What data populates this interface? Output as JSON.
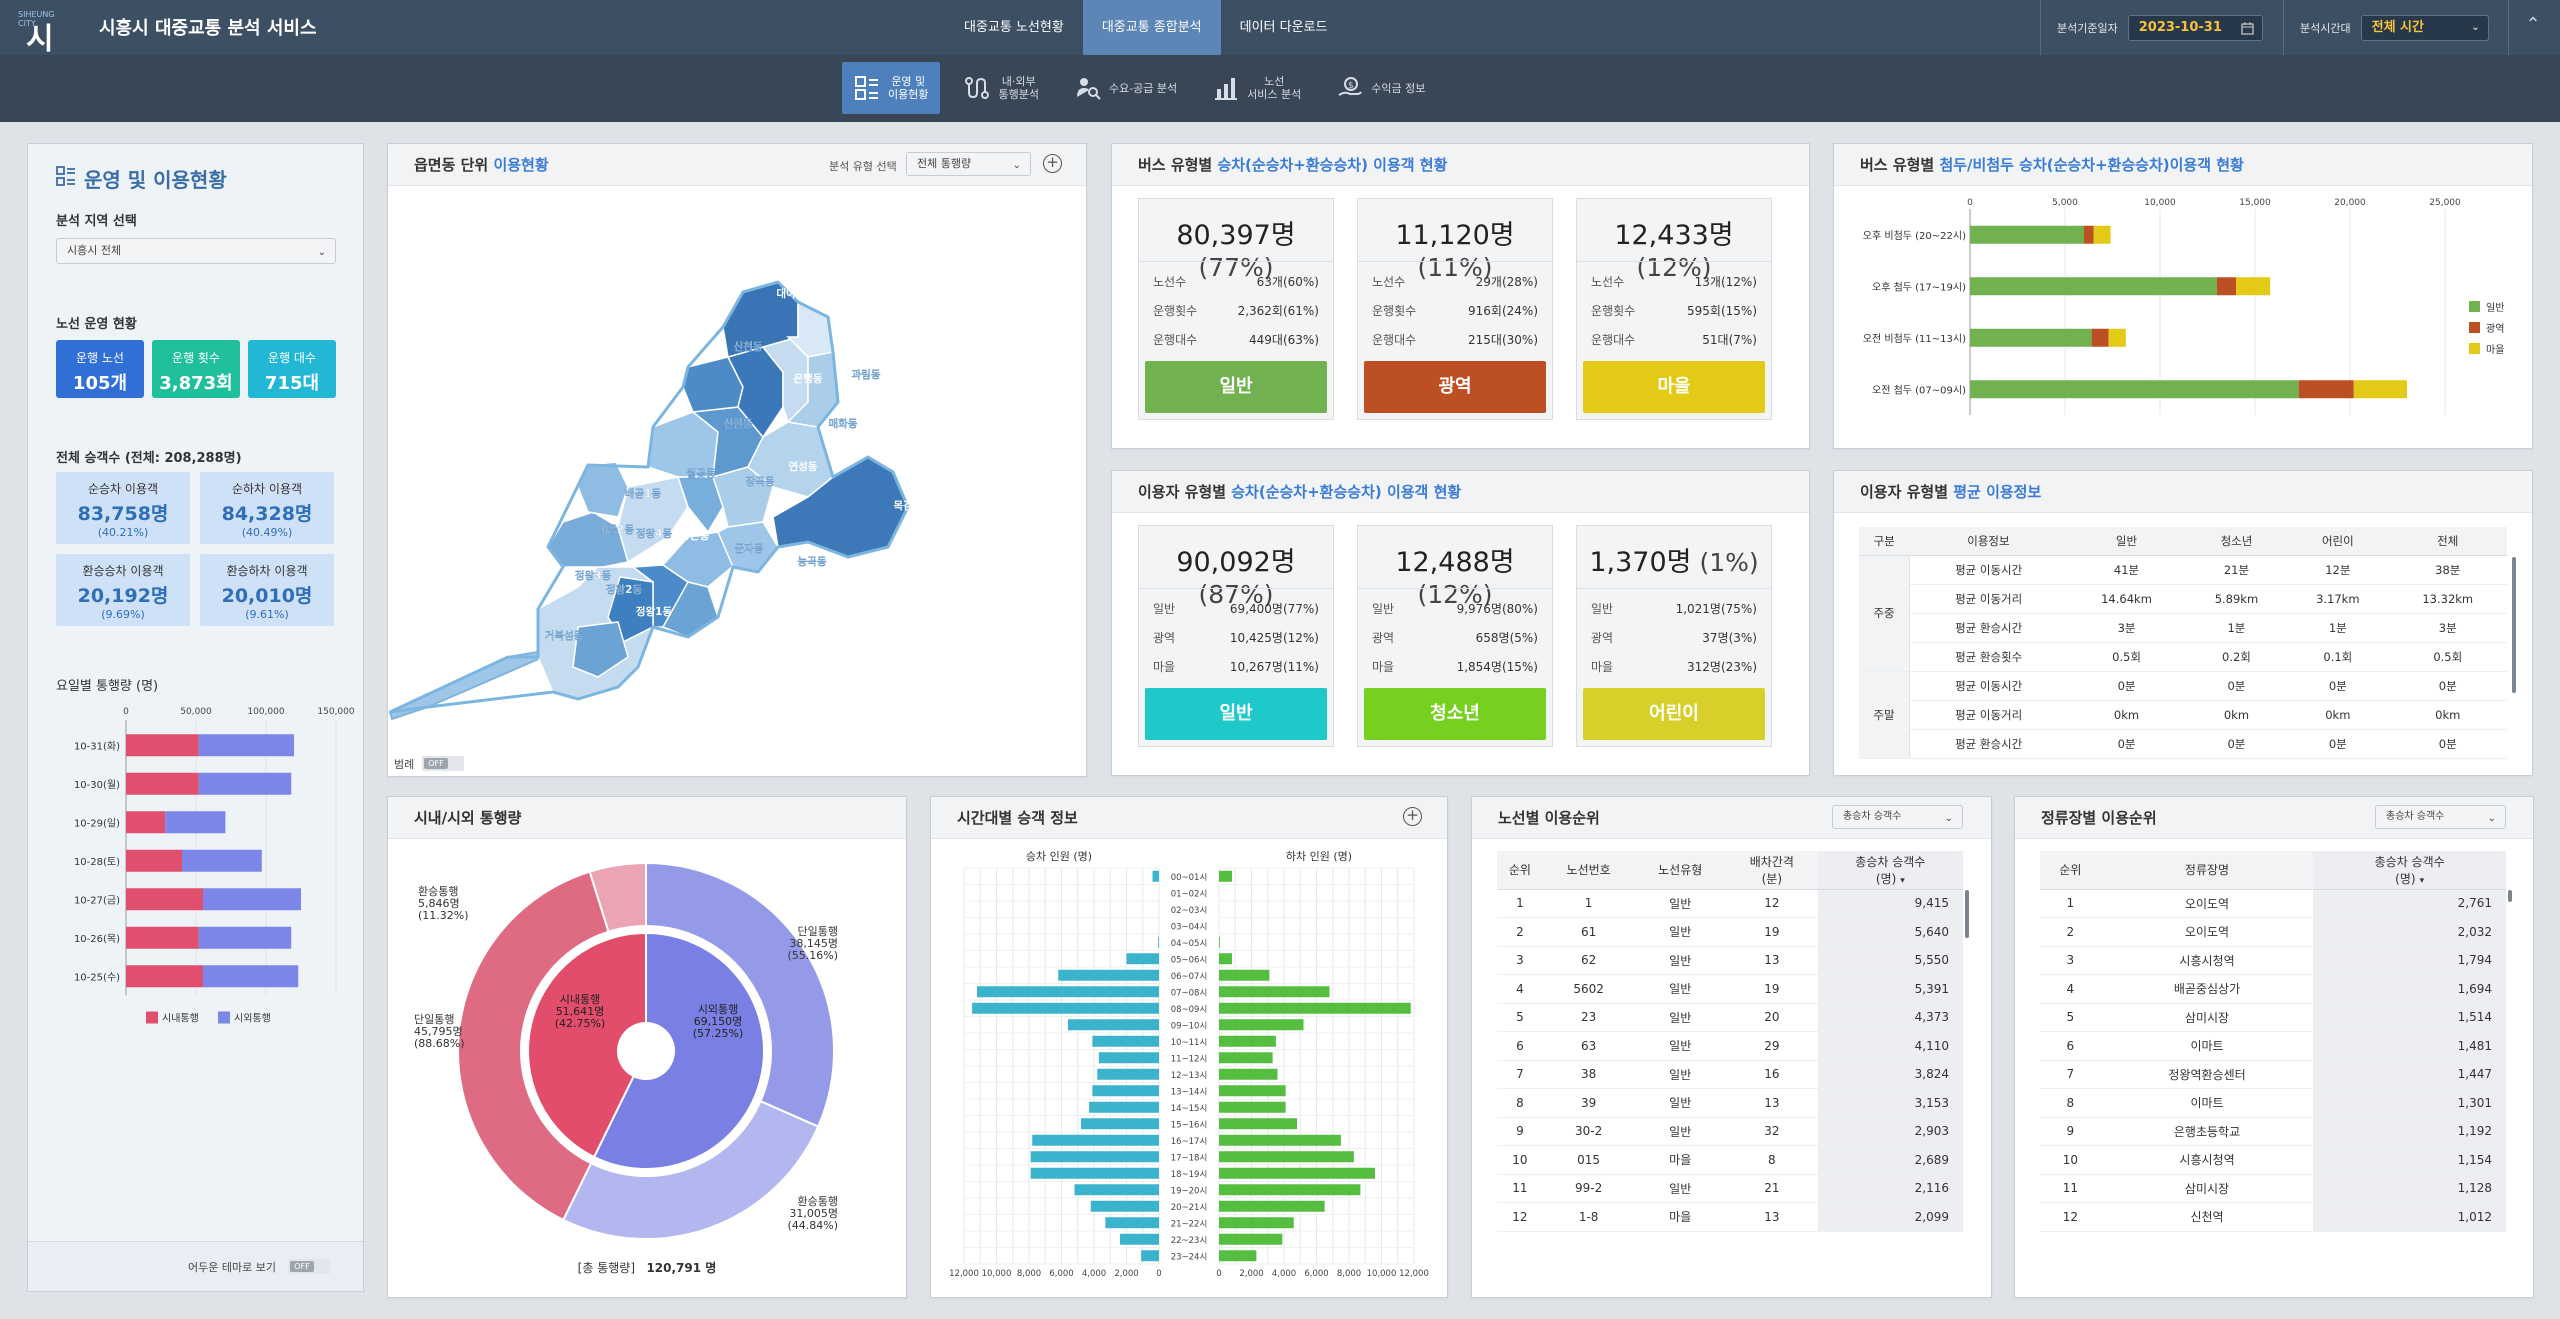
{
  "header": {
    "logo_small": "SIHEUNG CITY",
    "logo_big": "시흥",
    "title": "시흥시 대중교통 분석 서비스",
    "nav": [
      "대중교통 노선현황",
      "대중교통 종합분석",
      "데이터 다운로드"
    ],
    "date_label": "분석기준일자",
    "date_value": "2023-10-31",
    "time_label": "분석시간대",
    "time_value": "전체 시간"
  },
  "subnav": [
    {
      "l1": "운영 및",
      "l2": "이용현황"
    },
    {
      "l1": "내·외부",
      "l2": "통행분석"
    },
    {
      "l1": "수요-공급 분석",
      "l2": ""
    },
    {
      "l1": "노선",
      "l2": "서비스 분석"
    },
    {
      "l1": "수익금 정보",
      "l2": ""
    }
  ],
  "left": {
    "title": "운영 및 이용현황",
    "region_label": "분석 지역 선택",
    "region_value": "시흥시 전체",
    "ops_label": "노선 운영 현황",
    "ops": [
      {
        "label": "운행 노선",
        "value": "105개",
        "color": "#2f6fd6"
      },
      {
        "label": "운행 횟수",
        "value": "3,873회",
        "color": "#1fbf9c"
      },
      {
        "label": "운행 대수",
        "value": "715대",
        "color": "#21b7d5"
      }
    ],
    "pax_label": "전체 승객수 (전체: 208,288명)",
    "pax": [
      {
        "label": "순승차 이용객",
        "value": "83,758명",
        "pct": "(40.21%)"
      },
      {
        "label": "순하차 이용객",
        "value": "84,328명",
        "pct": "(40.49%)"
      },
      {
        "label": "환승승차 이용객",
        "value": "20,192명",
        "pct": "(9.69%)"
      },
      {
        "label": "환승하차 이용객",
        "value": "20,010명",
        "pct": "(9.61%)"
      }
    ],
    "dow_title": "요일별 통행량 (명)",
    "dark_label": "어두운 테마로 보기",
    "toggle_off": "OFF"
  },
  "dow_chart": {
    "type": "bar",
    "orientation": "horizontal",
    "stacked": true,
    "categories": [
      "10-31(화)",
      "10-30(월)",
      "10-29(일)",
      "10-28(토)",
      "10-27(금)",
      "10-26(목)",
      "10-25(수)"
    ],
    "series": [
      {
        "name": "시내통행",
        "color": "#e0506e",
        "values": [
          52000,
          52000,
          28000,
          40000,
          55000,
          52000,
          55000
        ]
      },
      {
        "name": "시외통행",
        "color": "#7b86e8",
        "values": [
          68000,
          66000,
          43000,
          57000,
          70000,
          66000,
          68000
        ]
      }
    ],
    "xlim": [
      0,
      150000
    ],
    "xticks": [
      "0",
      "50,000",
      "100,000",
      "150,000"
    ],
    "legend": "bottom"
  },
  "map_panel": {
    "title_a": "읍면동 단위 ",
    "title_b": "이용현황",
    "filter_label": "분석 유형 선택",
    "filter_value": "전체 통행량",
    "legend_label": "범례",
    "legend_toggle": "OFF",
    "districts": [
      "대야동",
      "신천동",
      "은행동",
      "과림동",
      "신현동",
      "매화동",
      "연성동",
      "장곡동",
      "목감동",
      "월곶동",
      "배곧1동",
      "배곧2동",
      "정왕본동",
      "군자동",
      "능곡동",
      "정왕3동",
      "정왕2동",
      "정왕1동",
      "정왕4동",
      "거북섬동"
    ]
  },
  "bus_type": {
    "title_a": "버스 유형별 ",
    "title_b": "승차(순승차+환승승차) 이용객 현황",
    "cards": [
      {
        "total": "80,397명",
        "pct": "(77%)",
        "rows": [
          [
            "노선수",
            "63개(60%)"
          ],
          [
            "운행횟수",
            "2,362회(61%)"
          ],
          [
            "운행대수",
            "449대(63%)"
          ]
        ],
        "button": "일반",
        "color": "#72b14f"
      },
      {
        "total": "11,120명",
        "pct": "(11%)",
        "rows": [
          [
            "노선수",
            "29개(28%)"
          ],
          [
            "운행횟수",
            "916회(24%)"
          ],
          [
            "운행대수",
            "215대(30%)"
          ]
        ],
        "button": "광역",
        "color": "#bd4f25"
      },
      {
        "total": "12,433명",
        "pct": "(12%)",
        "rows": [
          [
            "노선수",
            "13개(12%)"
          ],
          [
            "운행횟수",
            "595회(15%)"
          ],
          [
            "운행대수",
            "51대(7%)"
          ]
        ],
        "button": "마을",
        "color": "#e3ca17"
      }
    ]
  },
  "user_type": {
    "title_a": "이용자 유형별 ",
    "title_b": "승차(순승차+환승승차) 이용객 현황",
    "cards": [
      {
        "total": "90,092명",
        "pct": "(87%)",
        "rows": [
          [
            "일반",
            "69,400명(77%)"
          ],
          [
            "광역",
            "10,425명(12%)"
          ],
          [
            "마을",
            "10,267명(11%)"
          ]
        ],
        "button": "일반",
        "color": "#1fc8c9"
      },
      {
        "total": "12,488명",
        "pct": "(12%)",
        "rows": [
          [
            "일반",
            "9,976명(80%)"
          ],
          [
            "광역",
            "658명(5%)"
          ],
          [
            "마을",
            "1,854명(15%)"
          ]
        ],
        "button": "청소년",
        "color": "#77d01f"
      },
      {
        "total": "1,370명",
        "pct": "(1%)",
        "rows": [
          [
            "일반",
            "1,021명(75%)"
          ],
          [
            "광역",
            "37명(3%)"
          ],
          [
            "마을",
            "312명(23%)"
          ]
        ],
        "button": "어린이",
        "color": "#d7d02a"
      }
    ]
  },
  "peak_chart": {
    "type": "bar",
    "orientation": "horizontal",
    "stacked": true,
    "title_a": "버스 유형별 ",
    "title_b": "첨두/비첨두 승차(순승차+환승승차)이용객 현황",
    "categories": [
      "오후 비첨두 (20~22시)",
      "오후 첨두 (17~19시)",
      "오전 비첨두 (11~13시)",
      "오전 첨두 (07~09시)"
    ],
    "series": [
      {
        "name": "일반",
        "color": "#72b14f",
        "values": [
          6000,
          13000,
          6400,
          17300
        ]
      },
      {
        "name": "광역",
        "color": "#bd4f25",
        "values": [
          500,
          1000,
          900,
          2900
        ]
      },
      {
        "name": "마을",
        "color": "#e3ca17",
        "values": [
          900,
          1800,
          900,
          2800
        ]
      }
    ],
    "xlim": [
      0,
      25000
    ],
    "xticks": [
      "0",
      "5,000",
      "10,000",
      "15,000",
      "20,000",
      "25,000"
    ],
    "legend": "right"
  },
  "avg_info": {
    "title_a": "이용자 유형별 ",
    "title_b": "평균 이용정보",
    "headers": [
      "구분",
      "이용정보",
      "일반",
      "청소년",
      "어린이",
      "전체"
    ],
    "groups": [
      {
        "name": "주중",
        "rows": [
          [
            "평균 이동시간",
            "41분",
            "21분",
            "12분",
            "38분"
          ],
          [
            "평균 이동거리",
            "14.64km",
            "5.89km",
            "3.17km",
            "13.32km"
          ],
          [
            "평균 환승시간",
            "3분",
            "1분",
            "1분",
            "3분"
          ],
          [
            "평균 환승횟수",
            "0.5회",
            "0.2회",
            "0.1회",
            "0.5회"
          ]
        ]
      },
      {
        "name": "주말",
        "rows": [
          [
            "평균 이동시간",
            "0분",
            "0분",
            "0분",
            "0분"
          ],
          [
            "평균 이동거리",
            "0km",
            "0km",
            "0km",
            "0km"
          ],
          [
            "평균 환승시간",
            "0분",
            "0분",
            "0분",
            "0분"
          ]
        ]
      }
    ]
  },
  "inout": {
    "title": "시내/시외 통행량",
    "total_label": "[총 통행량]",
    "total_value": "120,791 명",
    "labels": [
      {
        "name": "환승통행",
        "value": "5,846명",
        "pct": "(11.32%)"
      },
      {
        "name": "단일통행",
        "value": "45,795명",
        "pct": "(88.68%)"
      },
      {
        "name": "단일통행",
        "value": "38,145명",
        "pct": "(55.16%)"
      },
      {
        "name": "환승통행",
        "value": "31,005명",
        "pct": "(44.84%)"
      },
      {
        "name": "시내통행",
        "value": "51,641명",
        "pct": "(42.75%)"
      },
      {
        "name": "시외통행",
        "value": "69,150명",
        "pct": "(57.25%)"
      }
    ]
  },
  "chart_data": {
    "type": "pie",
    "subtype": "double donut",
    "title": "시내/시외 통행량",
    "inner": [
      {
        "name": "시내통행",
        "value": 51641,
        "color": "#e24d6b"
      },
      {
        "name": "시외통행",
        "value": 69150,
        "color": "#7a80e3"
      }
    ],
    "outer": [
      {
        "name": "시내 단일통행",
        "value": 45795,
        "color": "#df6b83"
      },
      {
        "name": "시내 환승통행",
        "value": 5846,
        "color": "#eba4b3"
      },
      {
        "name": "시외 단일통행",
        "value": 38145,
        "color": "#949ae8"
      },
      {
        "name": "시외 환승통행",
        "value": 31005,
        "color": "#b3b7f0"
      }
    ]
  },
  "hourly": {
    "title": "시간대별 승객 정보",
    "left_label": "승차 인원 (명)",
    "right_label": "하차 인원 (명)",
    "hours": [
      "00~01시",
      "01~02시",
      "02~03시",
      "03~04시",
      "04~05시",
      "05~06시",
      "06~07시",
      "07~08시",
      "08~09시",
      "09~10시",
      "10~11시",
      "11~12시",
      "12~13시",
      "13~14시",
      "14~15시",
      "15~16시",
      "16~17시",
      "17~18시",
      "18~19시",
      "19~20시",
      "20~21시",
      "21~22시",
      "22~23시",
      "23~24시"
    ],
    "boarding": [
      400,
      0,
      0,
      0,
      50,
      2000,
      6200,
      11200,
      11500,
      5600,
      4100,
      3700,
      3800,
      4100,
      4300,
      4800,
      7800,
      7900,
      7900,
      5200,
      4200,
      3300,
      2400,
      1100
    ],
    "alighting": [
      800,
      0,
      0,
      0,
      50,
      800,
      3100,
      6800,
      11800,
      5200,
      3500,
      3300,
      3600,
      4100,
      4100,
      4800,
      7500,
      8300,
      9600,
      8700,
      6500,
      4600,
      3900,
      2300
    ],
    "ticks": [
      "12,000",
      "10,000",
      "8,000",
      "6,000",
      "4,000",
      "2,000",
      "0"
    ],
    "ticks_r": [
      "0",
      "2,000",
      "4,000",
      "6,000",
      "8,000",
      "10,000",
      "12,000"
    ]
  },
  "route_rank": {
    "title": "노선별 이용순위",
    "sort_value": "총승차 승객수",
    "headers": [
      "순위",
      "노선번호",
      "노선유형",
      "배차간격\n(분)",
      "총승차 승객수\n(명)"
    ],
    "rows": [
      [
        "1",
        "1",
        "일반",
        "12",
        "9,415"
      ],
      [
        "2",
        "61",
        "일반",
        "19",
        "5,640"
      ],
      [
        "3",
        "62",
        "일반",
        "13",
        "5,550"
      ],
      [
        "4",
        "5602",
        "일반",
        "19",
        "5,391"
      ],
      [
        "5",
        "23",
        "일반",
        "20",
        "4,373"
      ],
      [
        "6",
        "63",
        "일반",
        "29",
        "4,110"
      ],
      [
        "7",
        "38",
        "일반",
        "16",
        "3,824"
      ],
      [
        "8",
        "39",
        "일반",
        "13",
        "3,153"
      ],
      [
        "9",
        "30-2",
        "일반",
        "32",
        "2,903"
      ],
      [
        "10",
        "015",
        "마을",
        "8",
        "2,689"
      ],
      [
        "11",
        "99-2",
        "일반",
        "21",
        "2,116"
      ],
      [
        "12",
        "1-8",
        "마을",
        "13",
        "2,099"
      ]
    ]
  },
  "stop_rank": {
    "title": "정류장별 이용순위",
    "sort_value": "총승차 승객수",
    "headers": [
      "순위",
      "정류장명",
      "총승차 승객수\n(명)"
    ],
    "rows": [
      [
        "1",
        "오이도역",
        "2,761"
      ],
      [
        "2",
        "오이도역",
        "2,032"
      ],
      [
        "3",
        "시흥시청역",
        "1,794"
      ],
      [
        "4",
        "배곧중심상가",
        "1,694"
      ],
      [
        "5",
        "삼미시장",
        "1,514"
      ],
      [
        "6",
        "이마트",
        "1,481"
      ],
      [
        "7",
        "정왕역환승센터",
        "1,447"
      ],
      [
        "8",
        "이마트",
        "1,301"
      ],
      [
        "9",
        "은행초등학교",
        "1,192"
      ],
      [
        "10",
        "시흥시청역",
        "1,154"
      ],
      [
        "11",
        "삼미시장",
        "1,128"
      ],
      [
        "12",
        "신천역",
        "1,012"
      ]
    ]
  }
}
